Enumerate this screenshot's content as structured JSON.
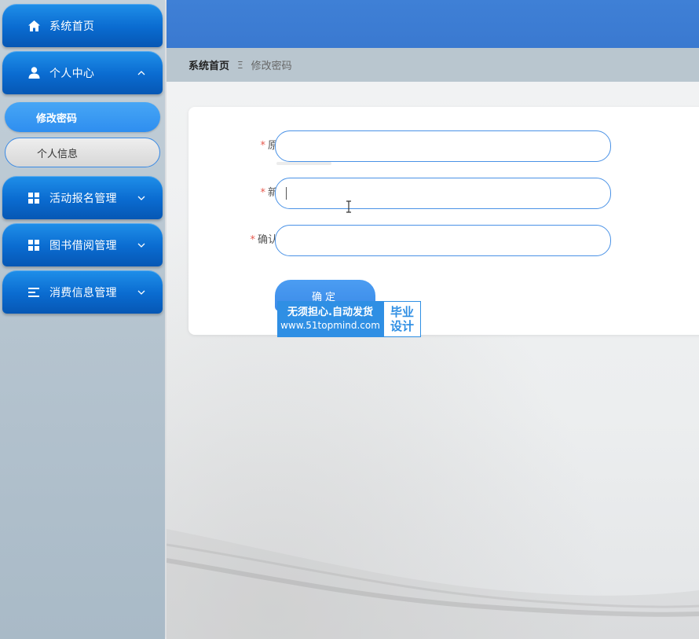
{
  "sidebar": {
    "items": [
      {
        "label": "系统首页",
        "icon": "home-icon"
      },
      {
        "label": "个人中心",
        "icon": "user-icon",
        "expanded": true,
        "children": [
          {
            "label": "修改密码",
            "active": true
          },
          {
            "label": "个人信息",
            "active": false
          }
        ]
      },
      {
        "label": "活动报名管理",
        "icon": "grid-icon"
      },
      {
        "label": "图书借阅管理",
        "icon": "grid-icon"
      },
      {
        "label": "消费信息管理",
        "icon": "list-icon"
      }
    ]
  },
  "breadcrumb": {
    "home": "系统首页",
    "separator": "Ξ",
    "current": "修改密码"
  },
  "form": {
    "fields": [
      {
        "label": "原密码",
        "required": true,
        "value": ""
      },
      {
        "label": "新密码",
        "required": true,
        "value": ""
      },
      {
        "label": "确认密码",
        "required": true,
        "value": ""
      }
    ],
    "required_mark": "*",
    "submit_label": "确定"
  },
  "watermark": {
    "line1": "无须担心.自动发货",
    "line2": "www.51topmind.com",
    "right1": "毕业",
    "right2": "设计"
  },
  "colors": {
    "topbar": "#3f80d6",
    "menu_blue": "#0a6bd0",
    "input_border": "#4a92e6",
    "required": "#e65a4f"
  }
}
